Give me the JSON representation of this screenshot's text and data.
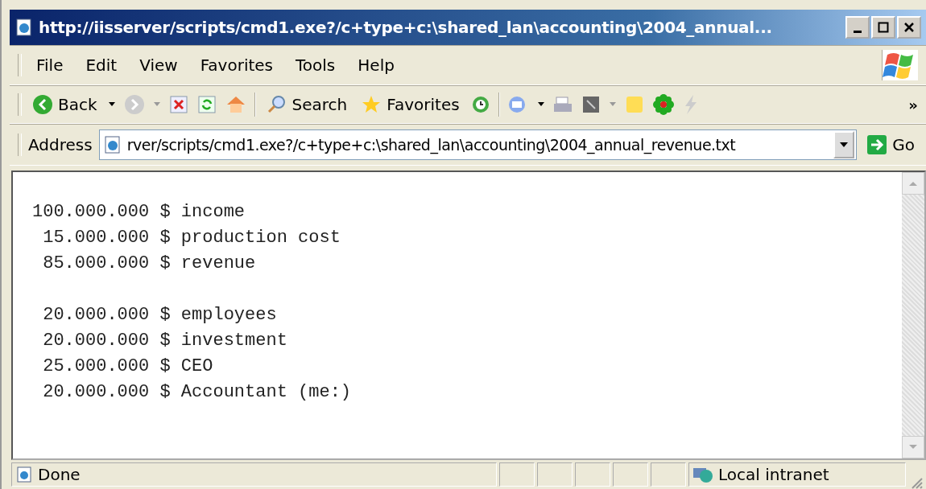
{
  "window": {
    "title": "http://iisserver/scripts/cmd1.exe?/c+type+c:\\shared_lan\\accounting\\2004_annual..."
  },
  "menu": [
    "File",
    "Edit",
    "View",
    "Favorites",
    "Tools",
    "Help"
  ],
  "toolbar": {
    "back": "Back",
    "search": "Search",
    "favorites": "Favorites",
    "more": "»"
  },
  "address": {
    "label": "Address",
    "value": "rver/scripts/cmd1.exe?/c+type+c:\\shared_lan\\accounting\\2004_annual_revenue.txt",
    "go": "Go"
  },
  "content": {
    "groups": [
      [
        "100.000.000 $ income",
        " 15.000.000 $ production cost",
        " 85.000.000 $ revenue"
      ],
      [
        " 20.000.000 $ employees",
        " 20.000.000 $ investment",
        " 25.000.000 $ CEO",
        " 20.000.000 $ Accountant (me:)"
      ]
    ]
  },
  "status_bar": {
    "text": "Done",
    "zone": "Local intranet"
  }
}
